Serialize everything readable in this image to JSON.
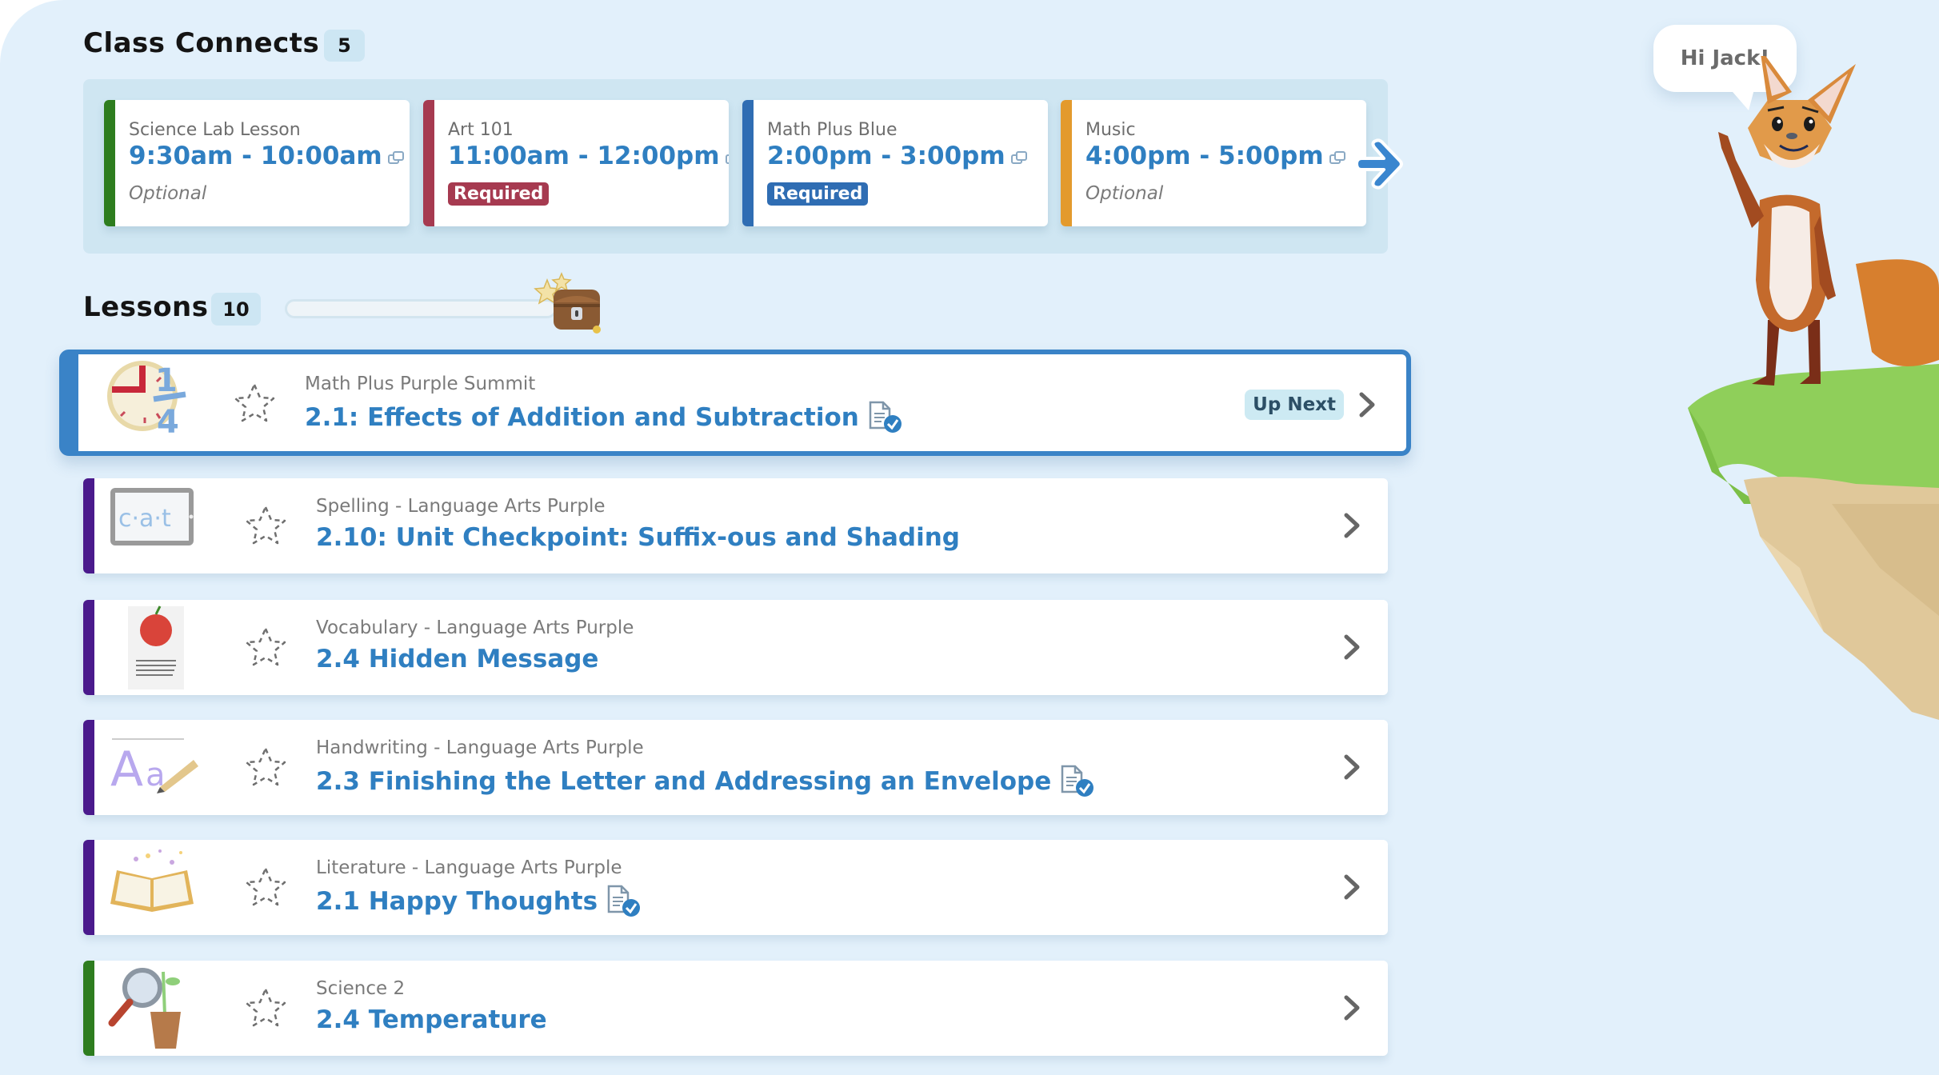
{
  "class_connects": {
    "title": "Class Connects",
    "count": "5",
    "cards": [
      {
        "name": "Science Lab Lesson",
        "time": "9:30am - 10:00am",
        "status": "Optional",
        "required": false,
        "color": "#2e7d1f"
      },
      {
        "name": "Art 101",
        "time": "11:00am - 12:00pm",
        "status": "Required",
        "required": true,
        "color": "#a63a50"
      },
      {
        "name": "Math Plus Blue",
        "time": "2:00pm - 3:00pm",
        "status": "Required",
        "required": true,
        "color": "#2f6db3"
      },
      {
        "name": "Music",
        "time": "4:00pm - 5:00pm",
        "status": "Optional",
        "required": false,
        "color": "#e39a2d"
      }
    ],
    "next_icon": "arrow-right-icon"
  },
  "lessons": {
    "title": "Lessons",
    "count": "10",
    "progress_percent": 0,
    "reward_icon": "treasure-chest-icon",
    "items": [
      {
        "subject": "Math Plus Purple Summit",
        "title": "2.1: Effects of Addition and Subtraction",
        "has_doc": true,
        "badge": "Up Next",
        "color": "#3a83c7",
        "thumb": "pie-fraction"
      },
      {
        "subject": "Spelling - Language Arts Purple",
        "title": "2.10: Unit Checkpoint: Suffix-ous and Shading",
        "has_doc": false,
        "badge": "",
        "color": "#4a1a8c",
        "thumb": "tablet-cat"
      },
      {
        "subject": "Vocabulary - Language Arts Purple",
        "title": "2.4 Hidden Message",
        "has_doc": false,
        "badge": "",
        "color": "#4a1a8c",
        "thumb": "apple-card"
      },
      {
        "subject": "Handwriting - Language Arts Purple",
        "title": "2.3 Finishing the Letter and Addressing an Envelope",
        "has_doc": true,
        "badge": "",
        "color": "#4a1a8c",
        "thumb": "letters-pencil"
      },
      {
        "subject": "Literature - Language Arts Purple",
        "title": "2.1 Happy Thoughts",
        "has_doc": true,
        "badge": "",
        "color": "#4a1a8c",
        "thumb": "open-book"
      },
      {
        "subject": "Science 2",
        "title": "2.4 Temperature",
        "has_doc": false,
        "badge": "",
        "color": "#2e7d1f",
        "thumb": "magnifier-plant"
      }
    ]
  },
  "mascot": {
    "greeting": "Hi Jack!",
    "icon": "fox-mascot-icon"
  },
  "colors": {
    "link_blue": "#2f7fc1",
    "page_bg": "#e2f0fb",
    "strip_bg": "#cfe6f2"
  }
}
